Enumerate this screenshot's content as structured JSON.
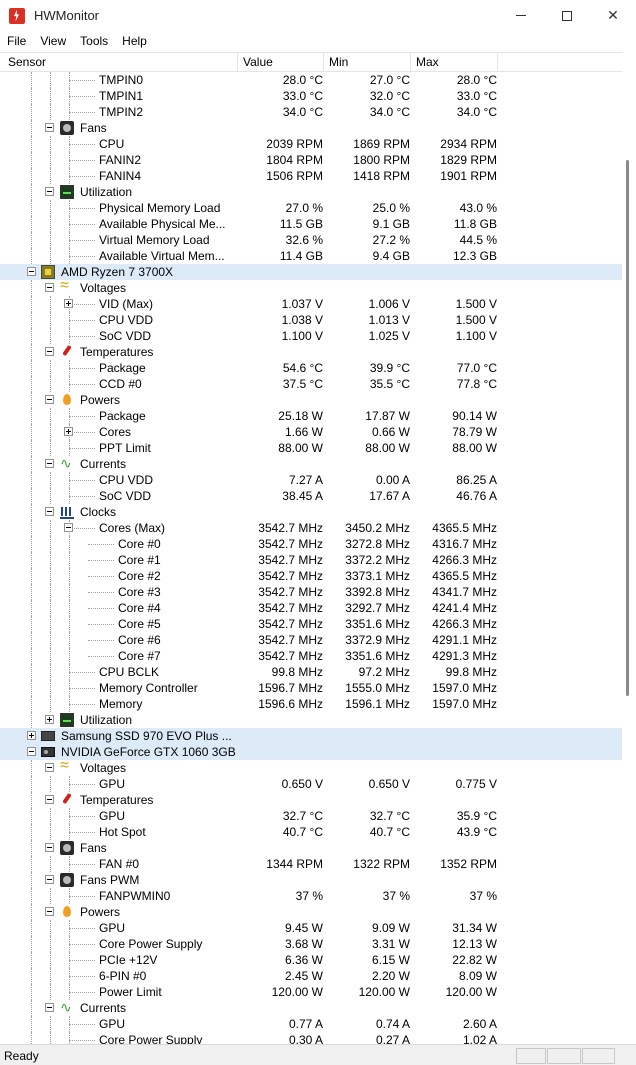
{
  "window": {
    "title": "HWMonitor"
  },
  "menu": [
    "File",
    "View",
    "Tools",
    "Help"
  ],
  "columns": {
    "sensor": "Sensor",
    "value": "Value",
    "min": "Min",
    "max": "Max"
  },
  "rows": [
    {
      "level": 3,
      "kind": "leaf",
      "label": "TMPIN0",
      "value": "28.0 °C",
      "min": "27.0 °C",
      "max": "28.0 °C"
    },
    {
      "level": 3,
      "kind": "leaf",
      "label": "TMPIN1",
      "value": "33.0 °C",
      "min": "32.0 °C",
      "max": "33.0 °C"
    },
    {
      "level": 3,
      "kind": "leaf",
      "label": "TMPIN2",
      "value": "34.0 °C",
      "min": "34.0 °C",
      "max": "34.0 °C"
    },
    {
      "level": 2,
      "kind": "group",
      "icon": "fan-icon",
      "label": "Fans"
    },
    {
      "level": 3,
      "kind": "leaf",
      "label": "CPU",
      "value": "2039 RPM",
      "min": "1869 RPM",
      "max": "2934 RPM"
    },
    {
      "level": 3,
      "kind": "leaf",
      "label": "FANIN2",
      "value": "1804 RPM",
      "min": "1800 RPM",
      "max": "1829 RPM"
    },
    {
      "level": 3,
      "kind": "leaf",
      "label": "FANIN4",
      "value": "1506 RPM",
      "min": "1418 RPM",
      "max": "1901 RPM"
    },
    {
      "level": 2,
      "kind": "group",
      "icon": "utilization-icon",
      "label": "Utilization"
    },
    {
      "level": 3,
      "kind": "leaf",
      "label": "Physical Memory Load",
      "value": "27.0 %",
      "min": "25.0 %",
      "max": "43.0 %"
    },
    {
      "level": 3,
      "kind": "leaf",
      "label": "Available Physical Me...",
      "value": "11.5 GB",
      "min": "9.1 GB",
      "max": "11.8 GB"
    },
    {
      "level": 3,
      "kind": "leaf",
      "label": "Virtual Memory Load",
      "value": "32.6 %",
      "min": "27.2 %",
      "max": "44.5 %"
    },
    {
      "level": 3,
      "kind": "leaf",
      "label": "Available Virtual Mem...",
      "value": "11.4 GB",
      "min": "9.4 GB",
      "max": "12.3 GB"
    },
    {
      "level": 1,
      "kind": "device",
      "icon": "cpu-chip-icon",
      "label": "AMD Ryzen 7 3700X",
      "selected": true
    },
    {
      "level": 2,
      "kind": "group",
      "icon": "voltage-icon",
      "label": "Voltages"
    },
    {
      "level": 3,
      "kind": "leaf",
      "label": "VID (Max)",
      "value": "1.037 V",
      "min": "1.006 V",
      "max": "1.500 V",
      "expander": "plus"
    },
    {
      "level": 3,
      "kind": "leaf",
      "label": "CPU VDD",
      "value": "1.038 V",
      "min": "1.013 V",
      "max": "1.500 V"
    },
    {
      "level": 3,
      "kind": "leaf",
      "label": "SoC VDD",
      "value": "1.100 V",
      "min": "1.025 V",
      "max": "1.100 V"
    },
    {
      "level": 2,
      "kind": "group",
      "icon": "temperature-icon",
      "label": "Temperatures"
    },
    {
      "level": 3,
      "kind": "leaf",
      "label": "Package",
      "value": "54.6 °C",
      "min": "39.9 °C",
      "max": "77.0 °C"
    },
    {
      "level": 3,
      "kind": "leaf",
      "label": "CCD #0",
      "value": "37.5 °C",
      "min": "35.5 °C",
      "max": "77.8 °C"
    },
    {
      "level": 2,
      "kind": "group",
      "icon": "power-icon",
      "label": "Powers"
    },
    {
      "level": 3,
      "kind": "leaf",
      "label": "Package",
      "value": "25.18 W",
      "min": "17.87 W",
      "max": "90.14 W"
    },
    {
      "level": 3,
      "kind": "leaf",
      "label": "Cores",
      "value": "1.66 W",
      "min": "0.66 W",
      "max": "78.79 W",
      "expander": "plus"
    },
    {
      "level": 3,
      "kind": "leaf",
      "label": "PPT Limit",
      "value": "88.00 W",
      "min": "88.00 W",
      "max": "88.00 W"
    },
    {
      "level": 2,
      "kind": "group",
      "icon": "current-icon",
      "label": "Currents"
    },
    {
      "level": 3,
      "kind": "leaf",
      "label": "CPU VDD",
      "value": "7.27 A",
      "min": "0.00 A",
      "max": "86.25 A"
    },
    {
      "level": 3,
      "kind": "leaf",
      "label": "SoC VDD",
      "value": "38.45 A",
      "min": "17.67 A",
      "max": "46.76 A"
    },
    {
      "level": 2,
      "kind": "group",
      "icon": "clock-icon",
      "label": "Clocks"
    },
    {
      "level": 3,
      "kind": "leaf",
      "label": "Cores (Max)",
      "value": "3542.7 MHz",
      "min": "3450.2 MHz",
      "max": "4365.5 MHz",
      "expander": "minus"
    },
    {
      "level": 4,
      "kind": "leaf",
      "label": "Core #0",
      "value": "3542.7 MHz",
      "min": "3272.8 MHz",
      "max": "4316.7 MHz"
    },
    {
      "level": 4,
      "kind": "leaf",
      "label": "Core #1",
      "value": "3542.7 MHz",
      "min": "3372.2 MHz",
      "max": "4266.3 MHz"
    },
    {
      "level": 4,
      "kind": "leaf",
      "label": "Core #2",
      "value": "3542.7 MHz",
      "min": "3373.1 MHz",
      "max": "4365.5 MHz"
    },
    {
      "level": 4,
      "kind": "leaf",
      "label": "Core #3",
      "value": "3542.7 MHz",
      "min": "3392.8 MHz",
      "max": "4341.7 MHz"
    },
    {
      "level": 4,
      "kind": "leaf",
      "label": "Core #4",
      "value": "3542.7 MHz",
      "min": "3292.7 MHz",
      "max": "4241.4 MHz"
    },
    {
      "level": 4,
      "kind": "leaf",
      "label": "Core #5",
      "value": "3542.7 MHz",
      "min": "3351.6 MHz",
      "max": "4266.3 MHz"
    },
    {
      "level": 4,
      "kind": "leaf",
      "label": "Core #6",
      "value": "3542.7 MHz",
      "min": "3372.9 MHz",
      "max": "4291.1 MHz"
    },
    {
      "level": 4,
      "kind": "leaf",
      "label": "Core #7",
      "value": "3542.7 MHz",
      "min": "3351.6 MHz",
      "max": "4291.3 MHz"
    },
    {
      "level": 3,
      "kind": "leaf",
      "label": "CPU BCLK",
      "value": "99.8 MHz",
      "min": "97.2 MHz",
      "max": "99.8 MHz"
    },
    {
      "level": 3,
      "kind": "leaf",
      "label": "Memory Controller",
      "value": "1596.7 MHz",
      "min": "1555.0 MHz",
      "max": "1597.0 MHz"
    },
    {
      "level": 3,
      "kind": "leaf",
      "label": "Memory",
      "value": "1596.6 MHz",
      "min": "1596.1 MHz",
      "max": "1597.0 MHz"
    },
    {
      "level": 2,
      "kind": "group",
      "icon": "utilization-icon",
      "label": "Utilization",
      "expander": "plus"
    },
    {
      "level": 1,
      "kind": "device",
      "icon": "ssd-icon",
      "label": "Samsung SSD 970 EVO Plus ...",
      "selected": true,
      "expander": "plus"
    },
    {
      "level": 1,
      "kind": "device",
      "icon": "gpu-icon",
      "label": "NVIDIA GeForce GTX 1060 3GB",
      "selected": true
    },
    {
      "level": 2,
      "kind": "group",
      "icon": "voltage-icon",
      "label": "Voltages"
    },
    {
      "level": 3,
      "kind": "leaf",
      "label": "GPU",
      "value": "0.650 V",
      "min": "0.650 V",
      "max": "0.775 V"
    },
    {
      "level": 2,
      "kind": "group",
      "icon": "temperature-icon",
      "label": "Temperatures"
    },
    {
      "level": 3,
      "kind": "leaf",
      "label": "GPU",
      "value": "32.7 °C",
      "min": "32.7 °C",
      "max": "35.9 °C"
    },
    {
      "level": 3,
      "kind": "leaf",
      "label": "Hot Spot",
      "value": "40.7 °C",
      "min": "40.7 °C",
      "max": "43.9 °C"
    },
    {
      "level": 2,
      "kind": "group",
      "icon": "fan-icon",
      "label": "Fans"
    },
    {
      "level": 3,
      "kind": "leaf",
      "label": "FAN #0",
      "value": "1344 RPM",
      "min": "1322 RPM",
      "max": "1352 RPM"
    },
    {
      "level": 2,
      "kind": "group",
      "icon": "fan-icon",
      "label": "Fans PWM"
    },
    {
      "level": 3,
      "kind": "leaf",
      "label": "FANPWMIN0",
      "value": "37 %",
      "min": "37 %",
      "max": "37 %"
    },
    {
      "level": 2,
      "kind": "group",
      "icon": "power-icon",
      "label": "Powers"
    },
    {
      "level": 3,
      "kind": "leaf",
      "label": "GPU",
      "value": "9.45 W",
      "min": "9.09 W",
      "max": "31.34 W"
    },
    {
      "level": 3,
      "kind": "leaf",
      "label": "Core Power Supply",
      "value": "3.68 W",
      "min": "3.31 W",
      "max": "12.13 W"
    },
    {
      "level": 3,
      "kind": "leaf",
      "label": "PCIe +12V",
      "value": "6.36 W",
      "min": "6.15 W",
      "max": "22.82 W"
    },
    {
      "level": 3,
      "kind": "leaf",
      "label": "6-PIN #0",
      "value": "2.45 W",
      "min": "2.20 W",
      "max": "8.09 W"
    },
    {
      "level": 3,
      "kind": "leaf",
      "label": "Power Limit",
      "value": "120.00 W",
      "min": "120.00 W",
      "max": "120.00 W"
    },
    {
      "level": 2,
      "kind": "group",
      "icon": "current-icon",
      "label": "Currents"
    },
    {
      "level": 3,
      "kind": "leaf",
      "label": "GPU",
      "value": "0.77 A",
      "min": "0.74 A",
      "max": "2.60 A"
    },
    {
      "level": 3,
      "kind": "leaf",
      "label": "Core Power Supply",
      "value": "0.30 A",
      "min": "0.27 A",
      "max": "1.02 A"
    }
  ],
  "status": {
    "text": "Ready"
  },
  "colors": {
    "selection": "#dcebf7",
    "app_icon": "#d93025"
  }
}
